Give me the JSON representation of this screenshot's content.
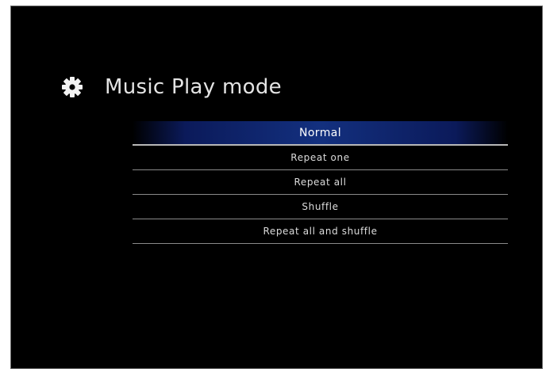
{
  "screen": {
    "title": "Music Play mode",
    "icon": "gear-icon",
    "selected_index": 0
  },
  "menu": {
    "items": [
      {
        "label": "Normal"
      },
      {
        "label": "Repeat one"
      },
      {
        "label": "Repeat all"
      },
      {
        "label": "Shuffle"
      },
      {
        "label": "Repeat all and shuffle"
      }
    ]
  },
  "colors": {
    "background": "#000000",
    "highlight": "#13307f",
    "text": "#dcdcdc"
  }
}
